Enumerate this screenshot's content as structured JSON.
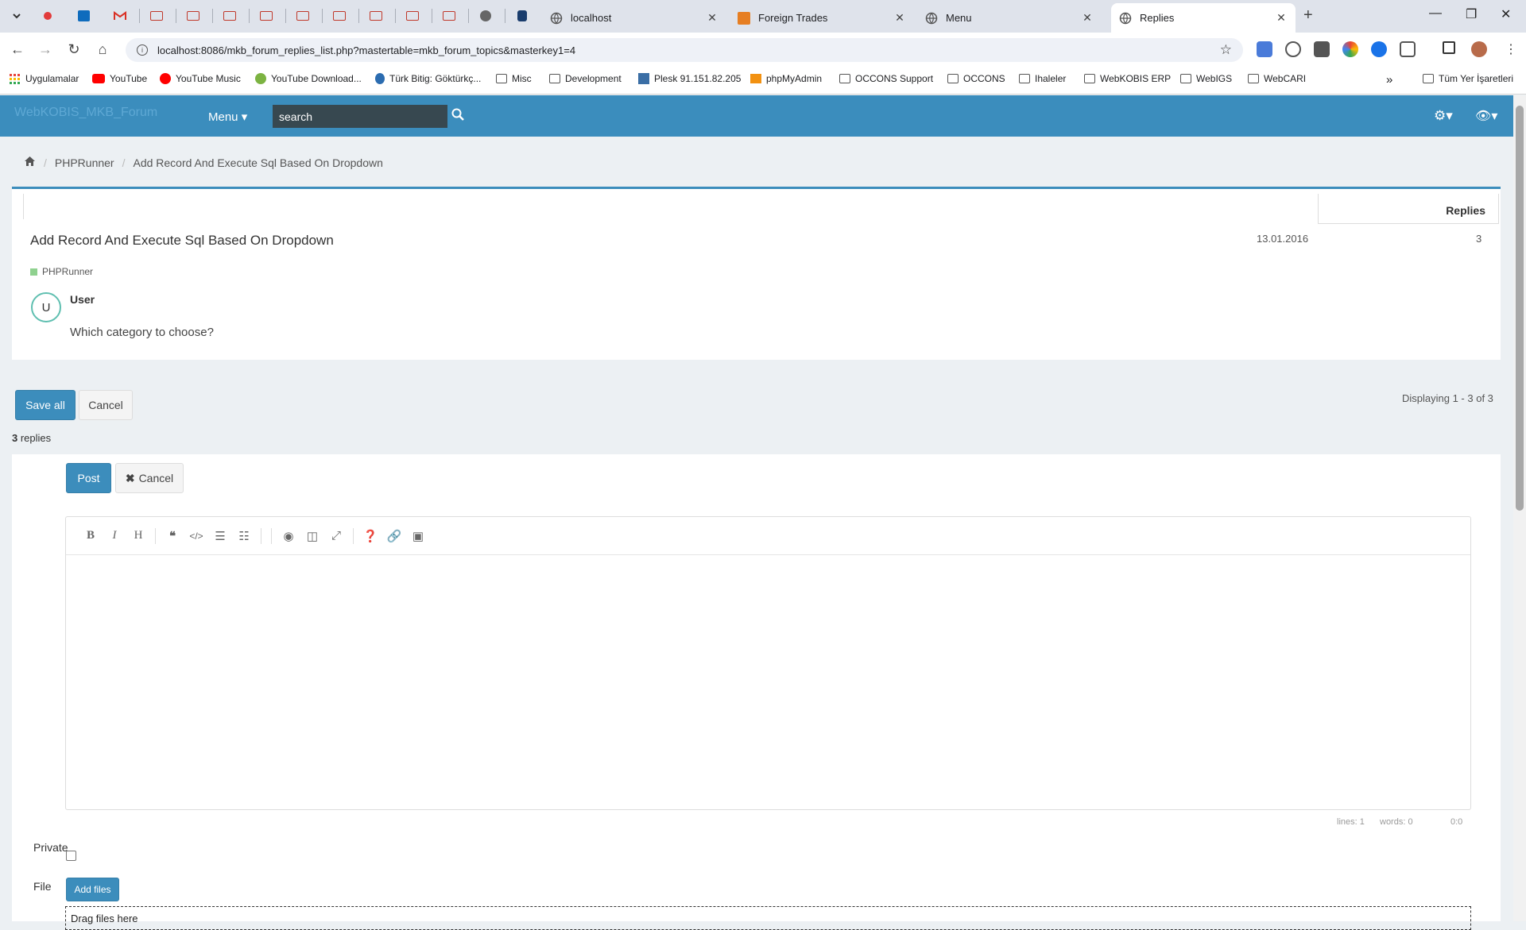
{
  "browser": {
    "tabs": [
      {
        "title": "localhost",
        "icon": "globe-icon"
      },
      {
        "title": "Foreign Trades",
        "icon": "app-icon"
      },
      {
        "title": "Menu",
        "icon": "globe-icon"
      },
      {
        "title": "Replies",
        "icon": "globe-icon",
        "active": true
      }
    ],
    "url": "localhost:8086/mkb_forum_replies_list.php?mastertable=mkb_forum_topics&masterkey1=4",
    "bookmarks": [
      "Uygulamalar",
      "YouTube",
      "YouTube Music",
      "YouTube Download...",
      "Türk Bitig: Göktürkç...",
      "Misc",
      "Development",
      "Plesk 91.151.82.205",
      "phpMyAdmin",
      "OCCONS Support",
      "OCCONS",
      "Ihaleler",
      "WebKOBIS ERP",
      "WebIGS",
      "WebCARI"
    ],
    "more_bookmarks": "»",
    "all_bookmarks": "Tüm Yer İşaretleri"
  },
  "app": {
    "brand": "WebKOBIS_MKB_Forum",
    "menu_label": "Menu ▾",
    "search_value": "search"
  },
  "breadcrumb": {
    "items": [
      "PHPRunner",
      "Add Record And Execute Sql Based On Dropdown"
    ]
  },
  "topic": {
    "replies_header": "Replies",
    "title": "Add Record And Execute Sql Based On Dropdown",
    "date": "13.01.2016",
    "replies": "3",
    "category": "PHPRunner",
    "avatar_letter": "U",
    "user": "User",
    "question": "Which category to choose?"
  },
  "actions": {
    "save_all": "Save all",
    "cancel": "Cancel",
    "displaying": "Displaying 1 - 3 of 3",
    "replies_count_num": "3",
    "replies_count_text": " replies"
  },
  "form": {
    "post": "Post",
    "cancel": "Cancel",
    "status_lines": "lines: 1",
    "status_words": "words: 0",
    "status_cursor": "0:0",
    "private_label": "Private",
    "file_label": "File",
    "add_files": "Add files",
    "drop_text": "Drag files here"
  },
  "colors": {
    "navbar": "#3b8dbd",
    "primary": "#3c8dbc",
    "category": "#8fd18f"
  }
}
